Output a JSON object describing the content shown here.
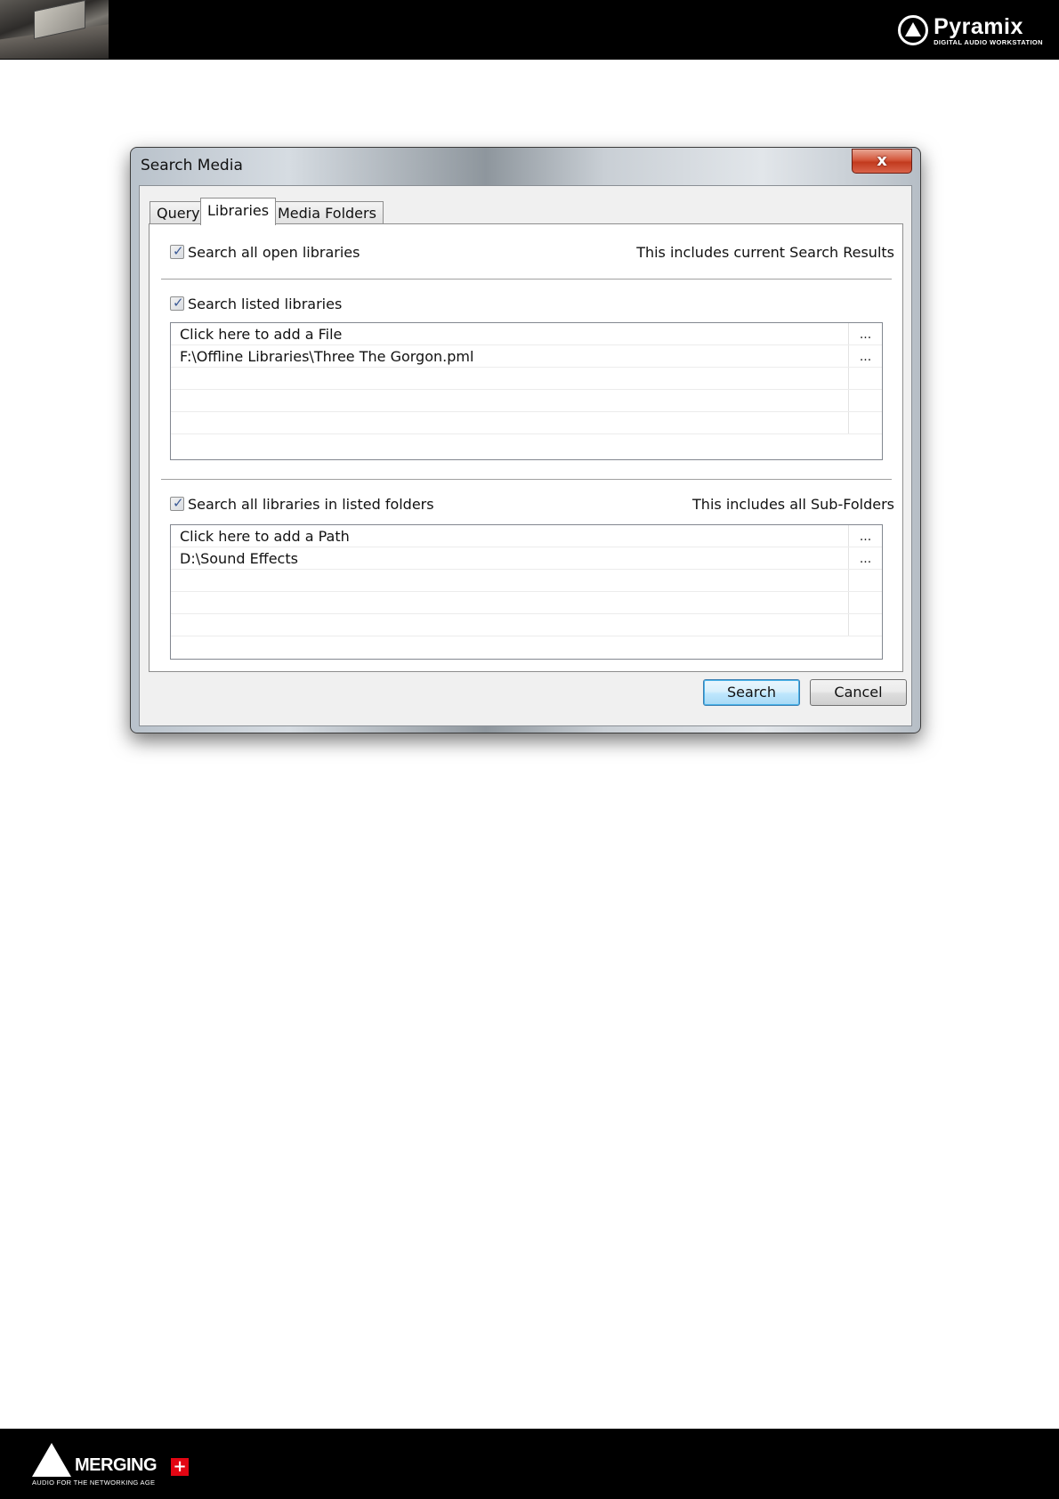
{
  "header": {
    "brand_name": "Pyramix",
    "brand_tagline": "DIGITAL AUDIO WORKSTATION"
  },
  "dialog": {
    "title": "Search Media",
    "close_label": "x",
    "tabs": [
      {
        "label": "Query",
        "active": false
      },
      {
        "label": "Libraries",
        "active": true
      },
      {
        "label": "Media Folders",
        "active": false
      }
    ],
    "open_libraries": {
      "checkbox_label": "Search all open libraries",
      "checked": true,
      "note": "This includes current Search Results"
    },
    "listed_libraries": {
      "checkbox_label": "Search listed libraries",
      "checked": true,
      "rows": [
        {
          "text": "Click here to add a File",
          "browse": "..."
        },
        {
          "text": "F:\\Offline Libraries\\Three The Gorgon.pml",
          "browse": "..."
        },
        {
          "text": "",
          "browse": ""
        },
        {
          "text": "",
          "browse": ""
        },
        {
          "text": "",
          "browse": ""
        }
      ]
    },
    "listed_folders": {
      "checkbox_label": "Search all libraries in listed folders",
      "checked": true,
      "note": "This includes all Sub-Folders",
      "rows": [
        {
          "text": "Click here to add a Path",
          "browse": "..."
        },
        {
          "text": "D:\\Sound Effects",
          "browse": "..."
        },
        {
          "text": "",
          "browse": ""
        },
        {
          "text": "",
          "browse": ""
        },
        {
          "text": "",
          "browse": ""
        }
      ]
    },
    "buttons": {
      "search": "Search",
      "cancel": "Cancel"
    }
  },
  "footer": {
    "brand_name": "MERGING",
    "brand_tagline": "AUDIO FOR THE NETWORKING AGE"
  }
}
